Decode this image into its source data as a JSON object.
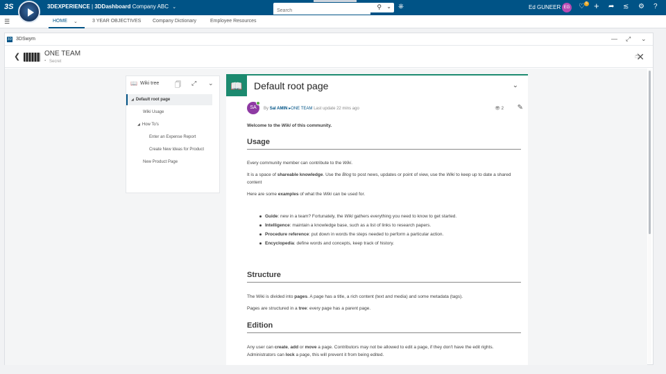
{
  "topbar": {
    "brand_bold_1": "3DEXPERIENCE",
    "brand_sep": " | ",
    "brand_bold_2": "3DDashboard",
    "brand_company": "Company ABC",
    "search_placeholder": "Search",
    "user_name": "Ed GUNEER",
    "user_initials": "EG",
    "notification_count": "5"
  },
  "dashboard_tabs": [
    {
      "label": "HOME"
    },
    {
      "label": "3 YEAR OBJECTIVES"
    },
    {
      "label": "Company Dictionary"
    },
    {
      "label": "Employee Resources"
    }
  ],
  "widget": {
    "app_name": "3DSwym",
    "community_name": "ONE TEAM",
    "community_privacy": "Secret"
  },
  "wiki_tree": {
    "title": "Wiki tree",
    "items": [
      {
        "label": "Default root page"
      },
      {
        "label": "Wiki Usage"
      },
      {
        "label": "How To's"
      },
      {
        "label": "Enter an Expense Report"
      },
      {
        "label": "Create New Ideas for Product"
      },
      {
        "label": "New Product Page"
      }
    ]
  },
  "page": {
    "title": "Default root page",
    "author_initials": "SA",
    "by": "By",
    "author": "Sal AMIN",
    "community": "ONE TEAM",
    "last_update": "Last update 22 mins ago",
    "views": "2",
    "welcome_a": "Welcome to the ",
    "welcome_b": "Wiki",
    "welcome_c": " of this community.",
    "usage_heading": "Usage",
    "usage_p1_a": "Every community member can contribute to the ",
    "usage_p1_b": "Wiki",
    "usage_p1_c": ".",
    "usage_p2_a": "It is a space of ",
    "usage_p2_b": "shareable knowledge",
    "usage_p2_c": ". Use the ",
    "usage_p2_d": "Blog",
    "usage_p2_e": " to post news, updates or point of view, use the ",
    "usage_p2_f": "Wiki",
    "usage_p2_g": " to keep up to date a shared content",
    "usage_p3_a": "Here are some ",
    "usage_p3_b": "examples",
    "usage_p3_c": " of what the ",
    "usage_p3_d": "Wiki",
    "usage_p3_e": " can be used for.",
    "examples": [
      {
        "term": "Guide",
        "text_a": ": new in a team? Fortunately, the ",
        "text_em": "Wiki",
        "text_b": " gathers everything you need to know to get started."
      },
      {
        "term": "Intelligence",
        "text_a": ": maintain a knowledge base, such as a list of links to research papers.",
        "text_em": "",
        "text_b": ""
      },
      {
        "term": "Procedure reference",
        "text_a": ": put down in words the steps needed to perform a particular action.",
        "text_em": "",
        "text_b": ""
      },
      {
        "term": "Encyclopedia",
        "text_a": ": define words and concepts, keep track of history.",
        "text_em": "",
        "text_b": ""
      }
    ],
    "structure_heading": "Structure",
    "structure_p1_a": "The Wiki is divided into ",
    "structure_p1_b": "pages",
    "structure_p1_c": ". A page has a title, a rich content (text and media) and some metadata (tags).",
    "structure_p2_a": "Pages are structured in a ",
    "structure_p2_b": "tree",
    "structure_p2_c": ": every page has a parent page.",
    "edition_heading": "Edition",
    "edition_p1_a": "Any user can ",
    "edition_p1_b": "create",
    "edition_p1_c": ", ",
    "edition_p1_d": "add",
    "edition_p1_e": " or ",
    "edition_p1_f": "move",
    "edition_p1_g": " a page. Contributors may not be allowed to edit a page, if they don't have the edit rights. Administrators can ",
    "edition_p1_h": "lock",
    "edition_p1_i": " a page, this will prevent it from being edited."
  },
  "colors": {
    "topbar": "#005386",
    "wiki_accent": "#1c8a6f",
    "avatar": "#8e3aa3",
    "user_badge": "#b84bb3"
  }
}
